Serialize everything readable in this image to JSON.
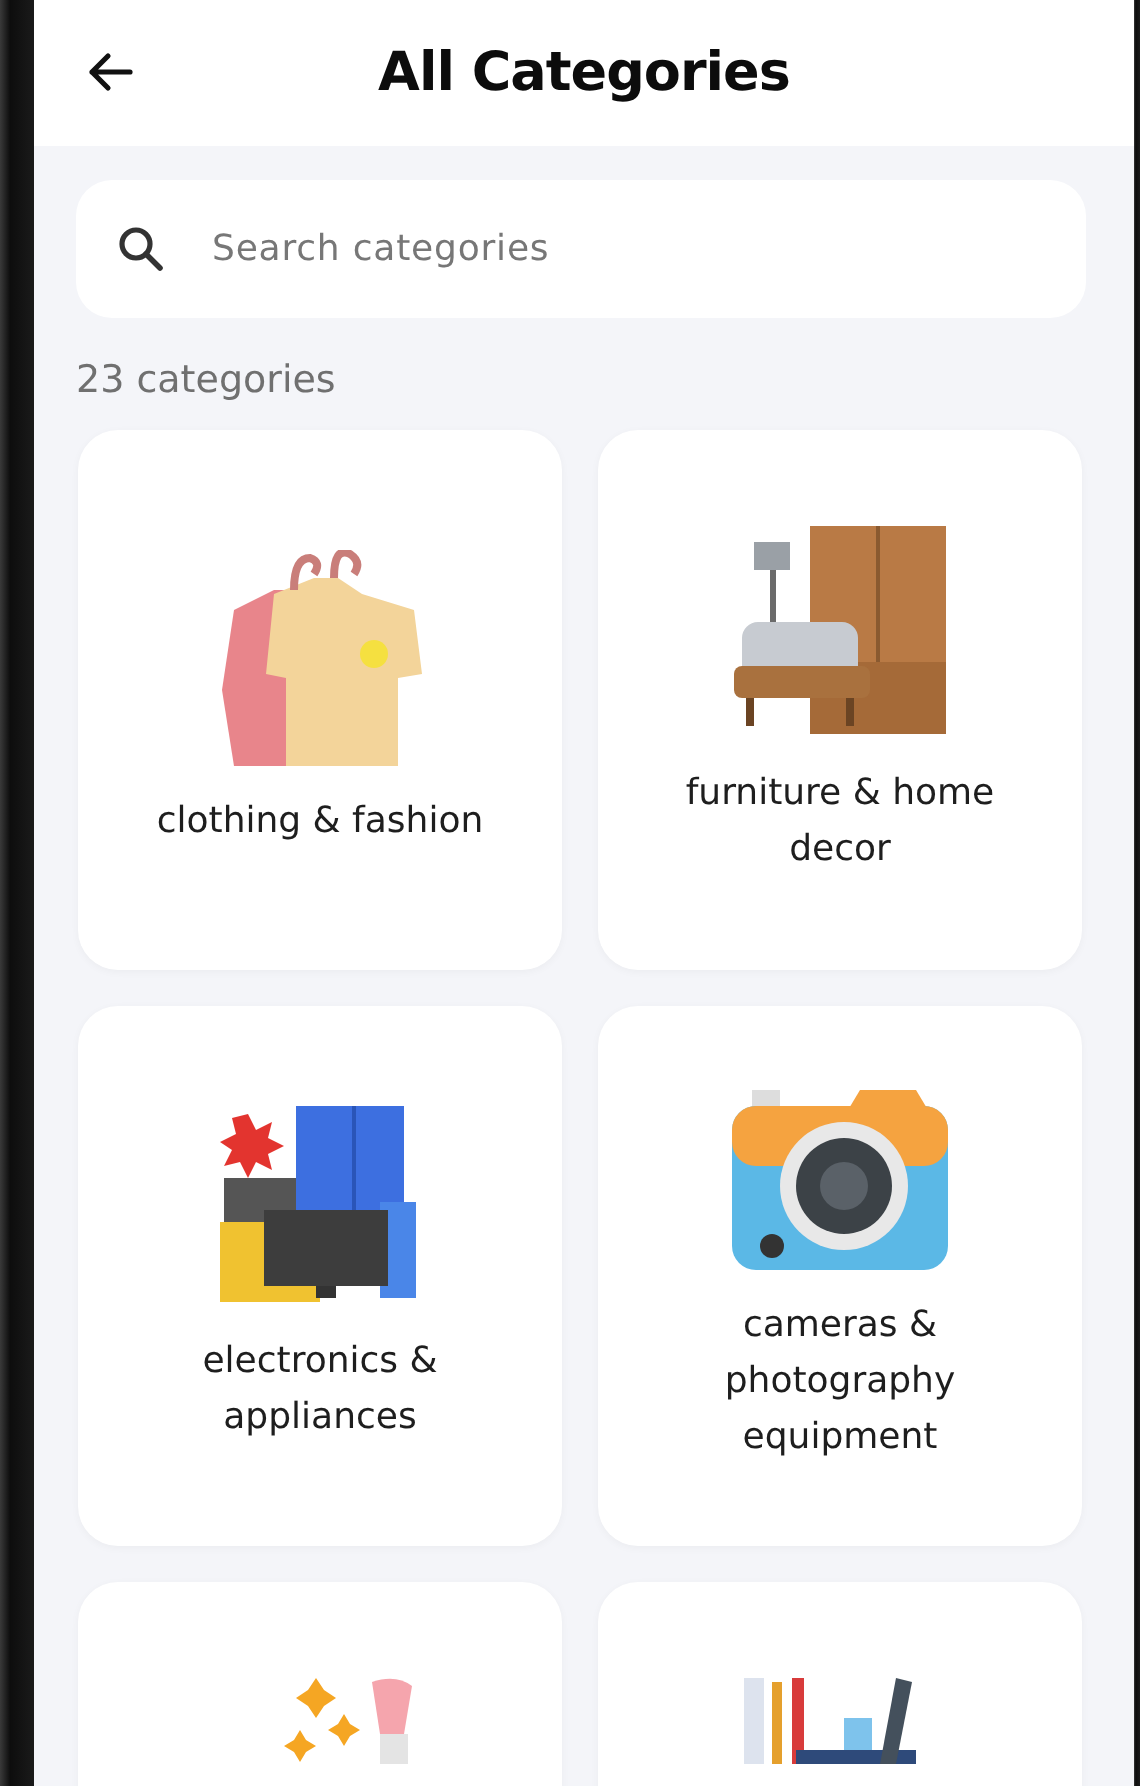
{
  "header": {
    "title": "All Categories"
  },
  "search": {
    "placeholder": "Search categories"
  },
  "count": "23 categories",
  "categories": [
    {
      "kind": "clothing",
      "label": "clothing & fashion"
    },
    {
      "kind": "furniture",
      "label": "furniture & home decor"
    },
    {
      "kind": "electronics",
      "label": "electronics & appliances"
    },
    {
      "kind": "camera",
      "label": "cameras & photography equipment"
    },
    {
      "kind": "beauty"
    },
    {
      "kind": "stationery"
    }
  ]
}
